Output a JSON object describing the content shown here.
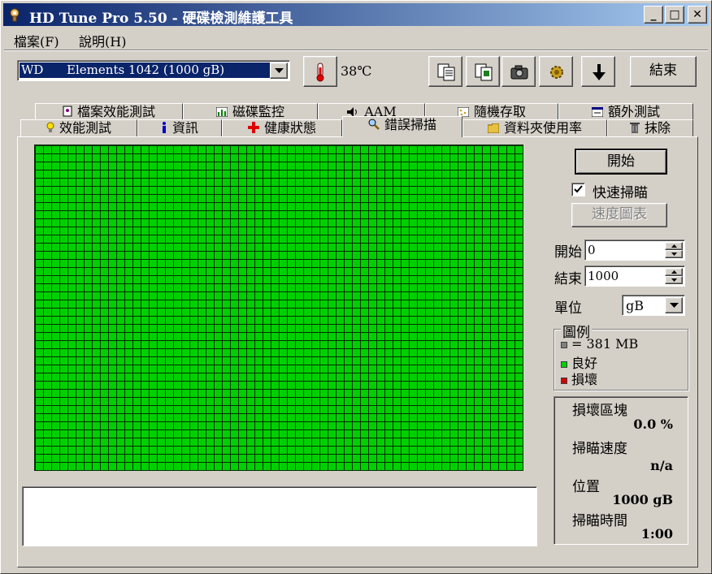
{
  "window": {
    "title": "HD Tune Pro 5.50 - 硬碟檢測維護工具",
    "min_glyph": "_",
    "max_glyph": "□",
    "close_glyph": "✕"
  },
  "menu": {
    "file": "檔案(F)",
    "help": "說明(H)"
  },
  "toolbar": {
    "drive": "WD      Elements 1042 (1000 gB)",
    "temperature": "38℃",
    "exit_label": "結束"
  },
  "tabs": {
    "row1": [
      "檔案效能測試",
      "磁碟監控",
      "AAM",
      "隨機存取",
      "額外測試"
    ],
    "row2": [
      "效能測試",
      "資訊",
      "健康狀態",
      "錯誤掃描",
      "資料夾使用率",
      "抹除"
    ],
    "active": "錯誤掃描"
  },
  "scan": {
    "start_button": "開始",
    "quick_scan_label": "快速掃瞄",
    "quick_scan_checked": true,
    "speed_map_button": "速度圖表",
    "start_label": "開始",
    "start_value": "0",
    "end_label": "結束",
    "end_value": "1000",
    "unit_label": "單位",
    "unit_value": "gB"
  },
  "legend": {
    "title": "圖例",
    "block_size": "= 381 MB",
    "good": "良好",
    "damaged": "損壞",
    "colors": {
      "block": "#808080",
      "good": "#00d000",
      "damaged": "#d00000"
    }
  },
  "stats": {
    "damaged_blocks_label": "損壞區塊",
    "damaged_blocks_value": "0.0 %",
    "scan_speed_label": "掃瞄速度",
    "scan_speed_value": "n/a",
    "position_label": "位置",
    "position_value": "1000 gB",
    "scan_time_label": "掃瞄時間",
    "scan_time_value": "1:00"
  }
}
